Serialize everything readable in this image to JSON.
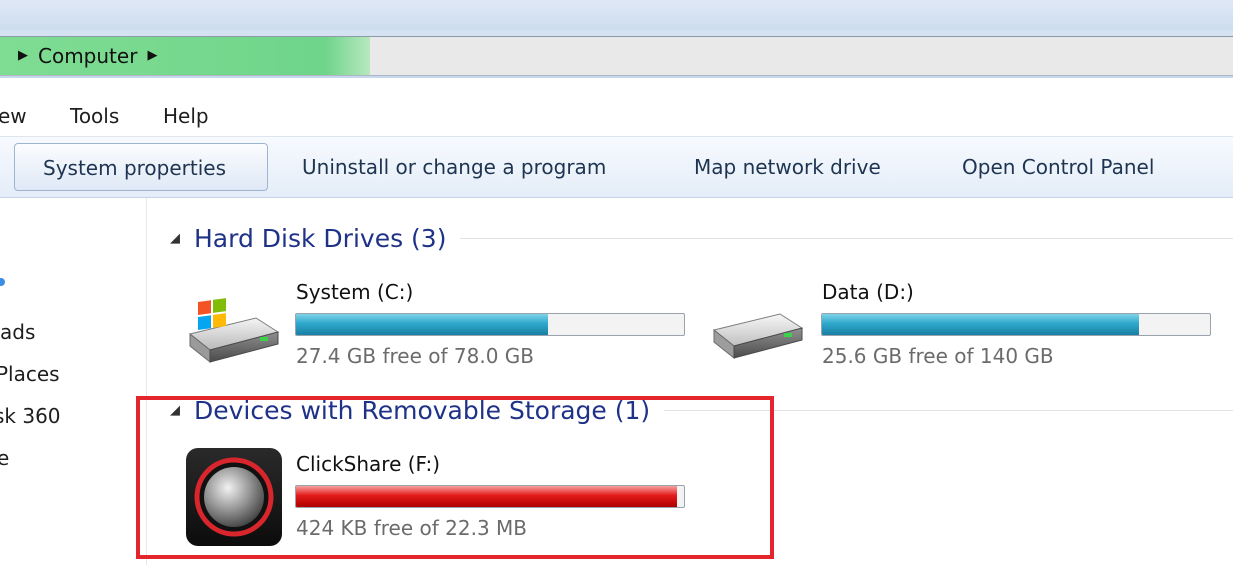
{
  "address": {
    "crumbs": [
      "Computer"
    ],
    "progress_fraction": 0.3
  },
  "menu": {
    "items": [
      "ew",
      "Tools",
      "Help"
    ]
  },
  "toolbar": {
    "buttons": [
      "System properties",
      "Uninstall or change a program",
      "Map network drive",
      "Open Control Panel"
    ]
  },
  "nav": {
    "items": [
      "ads",
      "Places",
      "sk 360",
      "e"
    ]
  },
  "sections": {
    "hard_disks": {
      "title": "Hard Disk Drives (3)",
      "drives": [
        {
          "name": "System (C:)",
          "free": "27.4 GB free of 78.0 GB",
          "used_fraction": 0.649,
          "icon": "windows-hard-drive-icon"
        },
        {
          "name": "Data (D:)",
          "free": "25.6 GB free of 140 GB",
          "used_fraction": 0.817,
          "icon": "hard-drive-icon"
        }
      ]
    },
    "removable": {
      "title": "Devices with Removable Storage (1)",
      "drives": [
        {
          "name": "ClickShare (F:)",
          "free": "424 KB free of 22.3 MB",
          "used_fraction": 0.981,
          "icon": "clickshare-button-icon"
        }
      ]
    }
  },
  "colors": {
    "bar_blue": "#2ea9cc",
    "bar_red": "#e41a1a",
    "highlight": "#e3262c",
    "section_title": "#1e3287"
  }
}
